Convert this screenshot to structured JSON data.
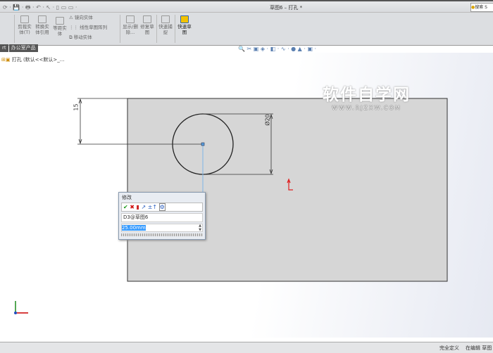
{
  "title": "草图6 – 打孔 *",
  "search_label": "搜索 S",
  "ribbon": {
    "trim": "剪裁实体(T)",
    "convert": "转换实体引用",
    "offset": "等距实体",
    "mirror": "镜向实体",
    "linear_pattern": "线性草图阵列",
    "move": "移动实体",
    "display_delete": "显示/删除...",
    "repair": "修复草图",
    "quick_snap": "快速捕捉",
    "rapid_sketch": "快速草图"
  },
  "tabs": [
    "rt",
    "办公室产品"
  ],
  "tree": {
    "root": "打孔 (默认<<默认>_..."
  },
  "sketch": {
    "dim_vertical": "15",
    "dim_diameter": "Ø20"
  },
  "watermark": {
    "title": "软件自学网",
    "url": "WWW.RJZXW.COM"
  },
  "modify_dialog": {
    "title": "修改",
    "dim_name": "D3@草图6",
    "value": "25.00mm"
  },
  "status": {
    "state": "完全定义",
    "mode": "在编辑 草图"
  }
}
